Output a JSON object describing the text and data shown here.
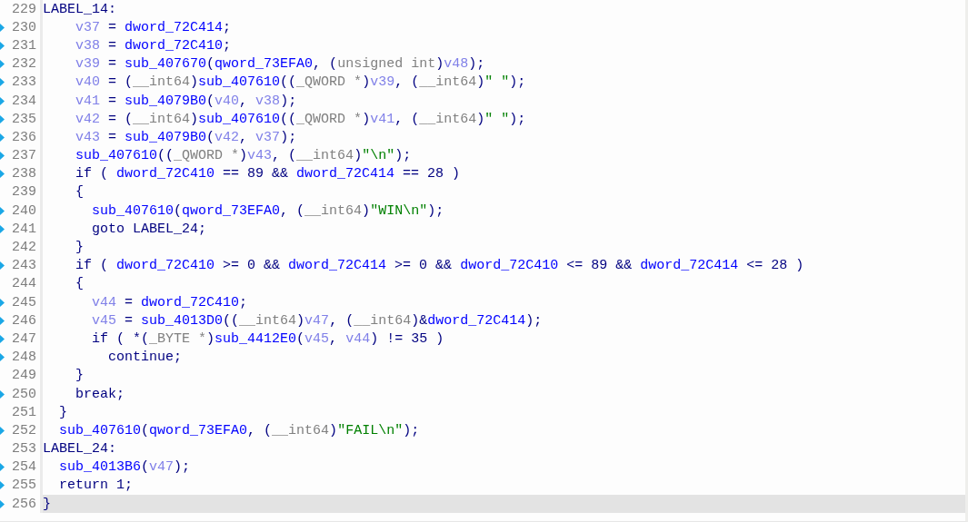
{
  "lines": [
    {
      "number": "229",
      "marker": false,
      "selected": false,
      "tokens": [
        {
          "kind": "plain",
          "text": "LABEL_14:"
        }
      ]
    },
    {
      "number": "230",
      "marker": true,
      "selected": false,
      "tokens": [
        {
          "kind": "var",
          "text": "    v37"
        },
        {
          "kind": "plain",
          "text": " = "
        },
        {
          "kind": "name",
          "text": "dword_72C414"
        },
        {
          "kind": "plain",
          "text": ";"
        }
      ]
    },
    {
      "number": "231",
      "marker": true,
      "selected": false,
      "tokens": [
        {
          "kind": "var",
          "text": "    v38"
        },
        {
          "kind": "plain",
          "text": " = "
        },
        {
          "kind": "name",
          "text": "dword_72C410"
        },
        {
          "kind": "plain",
          "text": ";"
        }
      ]
    },
    {
      "number": "232",
      "marker": true,
      "selected": false,
      "tokens": [
        {
          "kind": "var",
          "text": "    v39"
        },
        {
          "kind": "plain",
          "text": " = "
        },
        {
          "kind": "name",
          "text": "sub_407670"
        },
        {
          "kind": "plain",
          "text": "("
        },
        {
          "kind": "name",
          "text": "qword_73EFA0"
        },
        {
          "kind": "plain",
          "text": ", ("
        },
        {
          "kind": "type",
          "text": "unsigned int"
        },
        {
          "kind": "plain",
          "text": ")"
        },
        {
          "kind": "var",
          "text": "v48"
        },
        {
          "kind": "plain",
          "text": ");"
        }
      ]
    },
    {
      "number": "233",
      "marker": true,
      "selected": false,
      "tokens": [
        {
          "kind": "var",
          "text": "    v40"
        },
        {
          "kind": "plain",
          "text": " = ("
        },
        {
          "kind": "type",
          "text": "__int64"
        },
        {
          "kind": "plain",
          "text": ")"
        },
        {
          "kind": "name",
          "text": "sub_407610"
        },
        {
          "kind": "plain",
          "text": "(("
        },
        {
          "kind": "type",
          "text": "_QWORD *"
        },
        {
          "kind": "plain",
          "text": ")"
        },
        {
          "kind": "var",
          "text": "v39"
        },
        {
          "kind": "plain",
          "text": ", ("
        },
        {
          "kind": "type",
          "text": "__int64"
        },
        {
          "kind": "plain",
          "text": ")"
        },
        {
          "kind": "str",
          "text": "\" \""
        },
        {
          "kind": "plain",
          "text": ");"
        }
      ]
    },
    {
      "number": "234",
      "marker": true,
      "selected": false,
      "tokens": [
        {
          "kind": "var",
          "text": "    v41"
        },
        {
          "kind": "plain",
          "text": " = "
        },
        {
          "kind": "name",
          "text": "sub_4079B0"
        },
        {
          "kind": "plain",
          "text": "("
        },
        {
          "kind": "var",
          "text": "v40"
        },
        {
          "kind": "plain",
          "text": ", "
        },
        {
          "kind": "var",
          "text": "v38"
        },
        {
          "kind": "plain",
          "text": ");"
        }
      ]
    },
    {
      "number": "235",
      "marker": true,
      "selected": false,
      "tokens": [
        {
          "kind": "var",
          "text": "    v42"
        },
        {
          "kind": "plain",
          "text": " = ("
        },
        {
          "kind": "type",
          "text": "__int64"
        },
        {
          "kind": "plain",
          "text": ")"
        },
        {
          "kind": "name",
          "text": "sub_407610"
        },
        {
          "kind": "plain",
          "text": "(("
        },
        {
          "kind": "type",
          "text": "_QWORD *"
        },
        {
          "kind": "plain",
          "text": ")"
        },
        {
          "kind": "var",
          "text": "v41"
        },
        {
          "kind": "plain",
          "text": ", ("
        },
        {
          "kind": "type",
          "text": "__int64"
        },
        {
          "kind": "plain",
          "text": ")"
        },
        {
          "kind": "str",
          "text": "\" \""
        },
        {
          "kind": "plain",
          "text": ");"
        }
      ]
    },
    {
      "number": "236",
      "marker": true,
      "selected": false,
      "tokens": [
        {
          "kind": "var",
          "text": "    v43"
        },
        {
          "kind": "plain",
          "text": " = "
        },
        {
          "kind": "name",
          "text": "sub_4079B0"
        },
        {
          "kind": "plain",
          "text": "("
        },
        {
          "kind": "var",
          "text": "v42"
        },
        {
          "kind": "plain",
          "text": ", "
        },
        {
          "kind": "var",
          "text": "v37"
        },
        {
          "kind": "plain",
          "text": ");"
        }
      ]
    },
    {
      "number": "237",
      "marker": true,
      "selected": false,
      "tokens": [
        {
          "kind": "name",
          "text": "    sub_407610"
        },
        {
          "kind": "plain",
          "text": "(("
        },
        {
          "kind": "type",
          "text": "_QWORD *"
        },
        {
          "kind": "plain",
          "text": ")"
        },
        {
          "kind": "var",
          "text": "v43"
        },
        {
          "kind": "plain",
          "text": ", ("
        },
        {
          "kind": "type",
          "text": "__int64"
        },
        {
          "kind": "plain",
          "text": ")"
        },
        {
          "kind": "str",
          "text": "\"\\n\""
        },
        {
          "kind": "plain",
          "text": ");"
        }
      ]
    },
    {
      "number": "238",
      "marker": true,
      "selected": false,
      "tokens": [
        {
          "kind": "plain",
          "text": "    if ( "
        },
        {
          "kind": "name",
          "text": "dword_72C410"
        },
        {
          "kind": "plain",
          "text": " == 89 && "
        },
        {
          "kind": "name",
          "text": "dword_72C414"
        },
        {
          "kind": "plain",
          "text": " == 28 )"
        }
      ]
    },
    {
      "number": "239",
      "marker": false,
      "selected": false,
      "tokens": [
        {
          "kind": "plain",
          "text": "    {"
        }
      ]
    },
    {
      "number": "240",
      "marker": true,
      "selected": false,
      "tokens": [
        {
          "kind": "name",
          "text": "      sub_407610"
        },
        {
          "kind": "plain",
          "text": "("
        },
        {
          "kind": "name",
          "text": "qword_73EFA0"
        },
        {
          "kind": "plain",
          "text": ", ("
        },
        {
          "kind": "type",
          "text": "__int64"
        },
        {
          "kind": "plain",
          "text": ")"
        },
        {
          "kind": "str",
          "text": "\"WIN\\n\""
        },
        {
          "kind": "plain",
          "text": ");"
        }
      ]
    },
    {
      "number": "241",
      "marker": true,
      "selected": false,
      "tokens": [
        {
          "kind": "plain",
          "text": "      goto LABEL_24;"
        }
      ]
    },
    {
      "number": "242",
      "marker": false,
      "selected": false,
      "tokens": [
        {
          "kind": "plain",
          "text": "    }"
        }
      ]
    },
    {
      "number": "243",
      "marker": true,
      "selected": false,
      "tokens": [
        {
          "kind": "plain",
          "text": "    if ( "
        },
        {
          "kind": "name",
          "text": "dword_72C410"
        },
        {
          "kind": "plain",
          "text": " >= 0 && "
        },
        {
          "kind": "name",
          "text": "dword_72C414"
        },
        {
          "kind": "plain",
          "text": " >= 0 && "
        },
        {
          "kind": "name",
          "text": "dword_72C410"
        },
        {
          "kind": "plain",
          "text": " <= 89 && "
        },
        {
          "kind": "name",
          "text": "dword_72C414"
        },
        {
          "kind": "plain",
          "text": " <= 28 )"
        }
      ]
    },
    {
      "number": "244",
      "marker": false,
      "selected": false,
      "tokens": [
        {
          "kind": "plain",
          "text": "    {"
        }
      ]
    },
    {
      "number": "245",
      "marker": true,
      "selected": false,
      "tokens": [
        {
          "kind": "var",
          "text": "      v44"
        },
        {
          "kind": "plain",
          "text": " = "
        },
        {
          "kind": "name",
          "text": "dword_72C410"
        },
        {
          "kind": "plain",
          "text": ";"
        }
      ]
    },
    {
      "number": "246",
      "marker": true,
      "selected": false,
      "tokens": [
        {
          "kind": "var",
          "text": "      v45"
        },
        {
          "kind": "plain",
          "text": " = "
        },
        {
          "kind": "name",
          "text": "sub_4013D0"
        },
        {
          "kind": "plain",
          "text": "(("
        },
        {
          "kind": "type",
          "text": "__int64"
        },
        {
          "kind": "plain",
          "text": ")"
        },
        {
          "kind": "var",
          "text": "v47"
        },
        {
          "kind": "plain",
          "text": ", ("
        },
        {
          "kind": "type",
          "text": "__int64"
        },
        {
          "kind": "plain",
          "text": ")&"
        },
        {
          "kind": "name",
          "text": "dword_72C414"
        },
        {
          "kind": "plain",
          "text": ");"
        }
      ]
    },
    {
      "number": "247",
      "marker": true,
      "selected": false,
      "tokens": [
        {
          "kind": "plain",
          "text": "      if ( *("
        },
        {
          "kind": "type",
          "text": "_BYTE *"
        },
        {
          "kind": "plain",
          "text": ")"
        },
        {
          "kind": "name",
          "text": "sub_4412E0"
        },
        {
          "kind": "plain",
          "text": "("
        },
        {
          "kind": "var",
          "text": "v45"
        },
        {
          "kind": "plain",
          "text": ", "
        },
        {
          "kind": "var",
          "text": "v44"
        },
        {
          "kind": "plain",
          "text": ") != 35 )"
        }
      ]
    },
    {
      "number": "248",
      "marker": true,
      "selected": false,
      "tokens": [
        {
          "kind": "plain",
          "text": "        continue;"
        }
      ]
    },
    {
      "number": "249",
      "marker": false,
      "selected": false,
      "tokens": [
        {
          "kind": "plain",
          "text": "    }"
        }
      ]
    },
    {
      "number": "250",
      "marker": true,
      "selected": false,
      "tokens": [
        {
          "kind": "plain",
          "text": "    break;"
        }
      ]
    },
    {
      "number": "251",
      "marker": false,
      "selected": false,
      "tokens": [
        {
          "kind": "plain",
          "text": "  }"
        }
      ]
    },
    {
      "number": "252",
      "marker": true,
      "selected": false,
      "tokens": [
        {
          "kind": "name",
          "text": "  sub_407610"
        },
        {
          "kind": "plain",
          "text": "("
        },
        {
          "kind": "name",
          "text": "qword_73EFA0"
        },
        {
          "kind": "plain",
          "text": ", ("
        },
        {
          "kind": "type",
          "text": "__int64"
        },
        {
          "kind": "plain",
          "text": ")"
        },
        {
          "kind": "str",
          "text": "\"FAIL\\n\""
        },
        {
          "kind": "plain",
          "text": ");"
        }
      ]
    },
    {
      "number": "253",
      "marker": false,
      "selected": false,
      "tokens": [
        {
          "kind": "plain",
          "text": "LABEL_24:"
        }
      ]
    },
    {
      "number": "254",
      "marker": true,
      "selected": false,
      "tokens": [
        {
          "kind": "name",
          "text": "  sub_4013B6"
        },
        {
          "kind": "plain",
          "text": "("
        },
        {
          "kind": "var",
          "text": "v47"
        },
        {
          "kind": "plain",
          "text": ");"
        }
      ]
    },
    {
      "number": "255",
      "marker": true,
      "selected": false,
      "tokens": [
        {
          "kind": "plain",
          "text": "  return 1;"
        }
      ]
    },
    {
      "number": "256",
      "marker": true,
      "selected": true,
      "tokens": [
        {
          "kind": "plain",
          "text": "}"
        }
      ]
    }
  ]
}
